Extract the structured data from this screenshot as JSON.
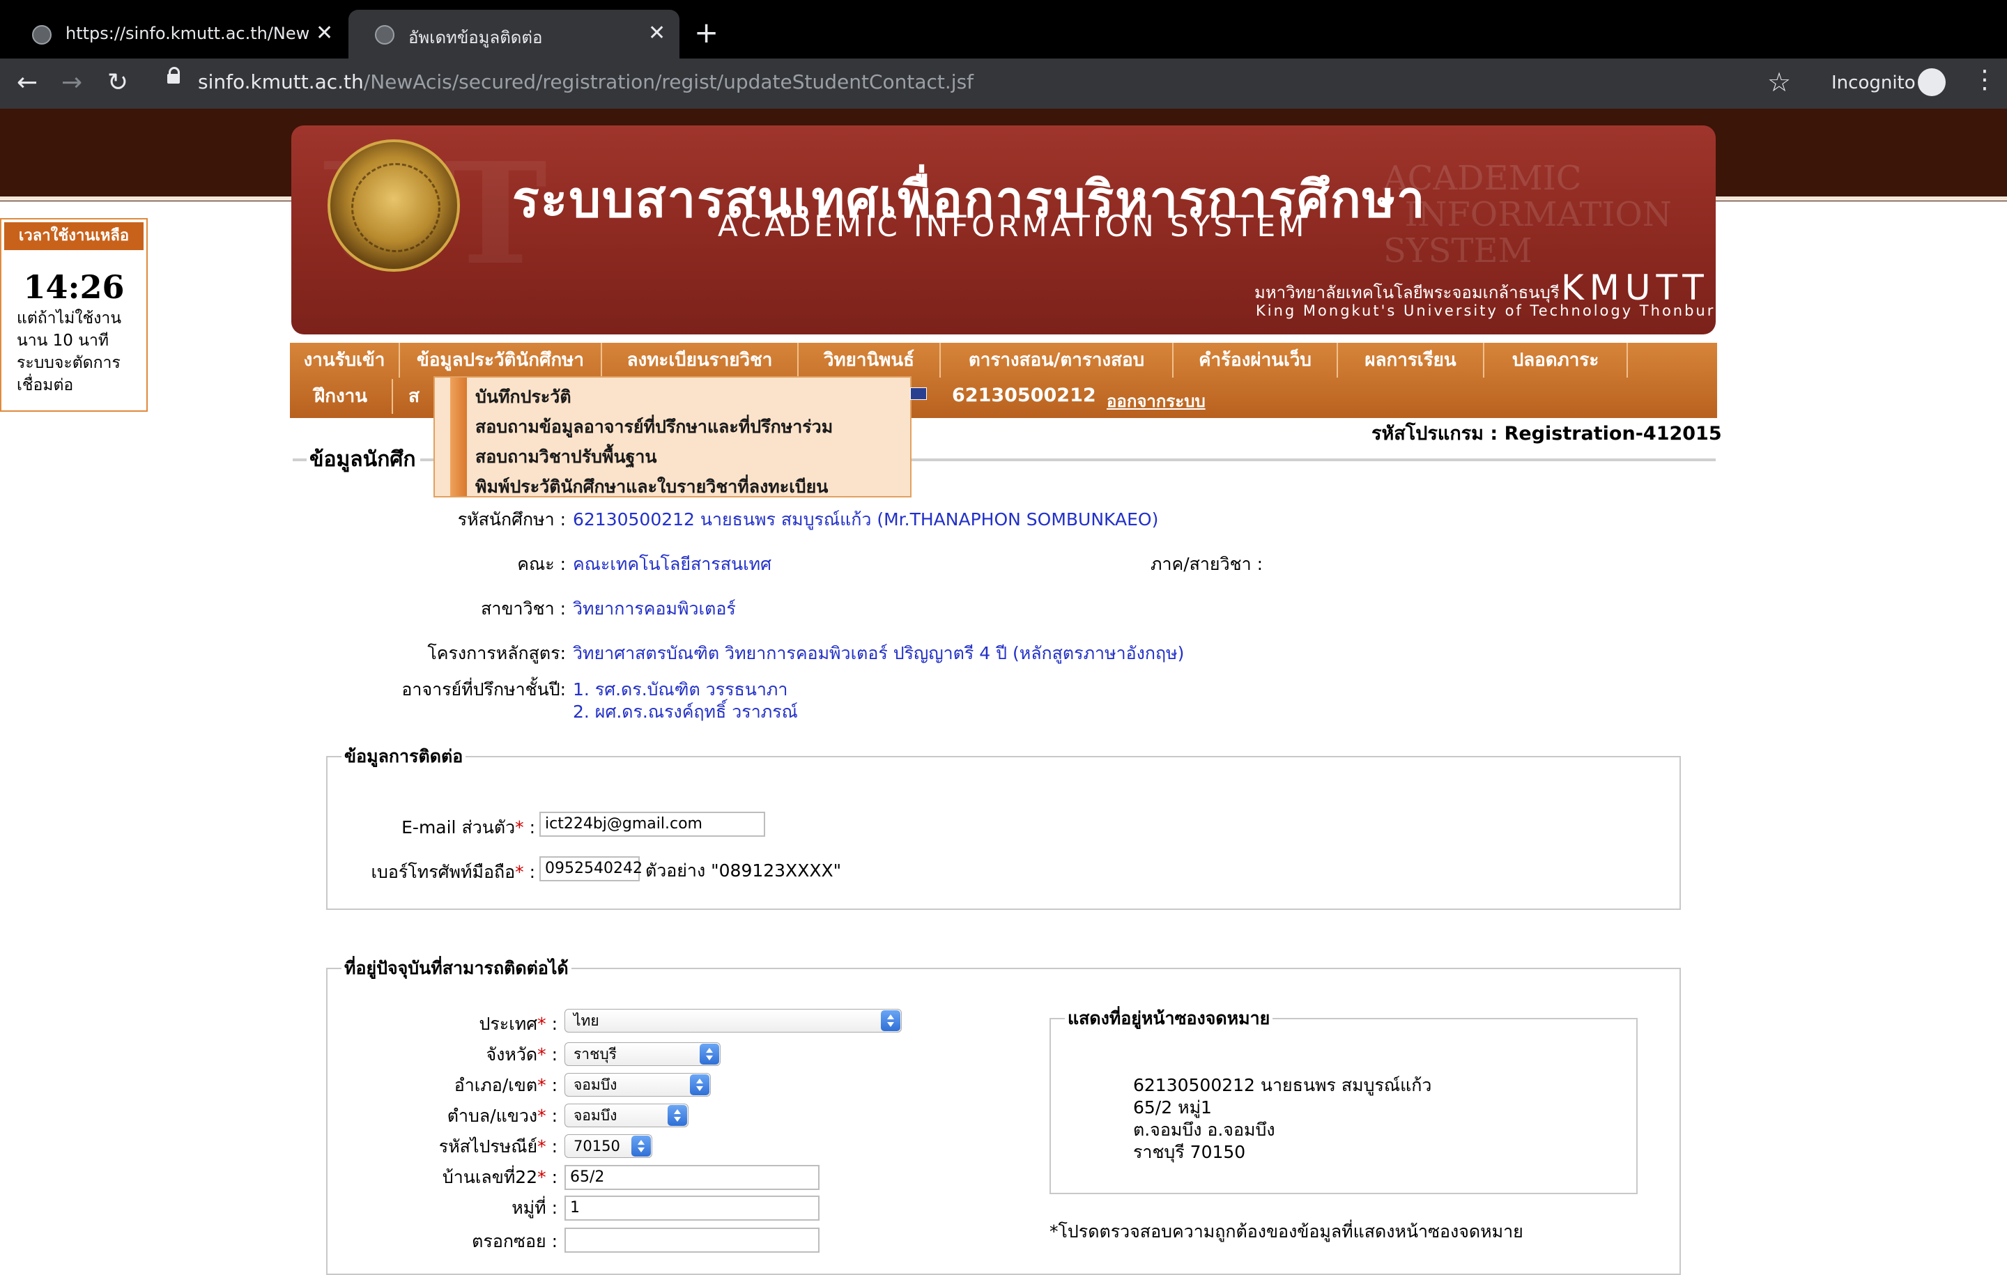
{
  "browser": {
    "tabs": [
      {
        "title": "https://sinfo.kmutt.ac.th/NewAcis/"
      },
      {
        "title": "อัพเดทข้อมูลติดต่อ"
      }
    ],
    "new_tab": "+",
    "url_host": "sinfo.kmutt.ac.th",
    "url_path": "/NewAcis/secured/registration/regist/updateStudentContact.jsf",
    "incognito_label": "Incognito"
  },
  "banner": {
    "title_th": "ระบบสารสนเทศเพื่อการบริหารการศึกษา",
    "title_en": "ACADEMIC INFORMATION SYSTEM",
    "university_th": "มหาวิทยาลัยเทคโนโลยีพระจอมเกล้าธนบุรี",
    "university_abbr": "KMUTT",
    "university_en": "King Mongkut's University of Technology Thonburi"
  },
  "session": {
    "header": "เวลาใช้งานเหลือ",
    "time": "14:26",
    "message": "แต่ถ้าไม่ใช้งานนาน 10 นาที ระบบจะตัดการเชื่อมต่อ"
  },
  "nav": {
    "row1": [
      "งานรับเข้า",
      "ข้อมูลประวัตินักศึกษา",
      "ลงทะเบียนรายวิชา",
      "วิทยานิพนธ์",
      "ตารางสอน/ตารางสอบ",
      "คำร้องผ่านเว็บ",
      "ผลการเรียน",
      "ปลอดภาระ"
    ],
    "row2": [
      "ฝึกงาน",
      "ส"
    ],
    "user_id": "62130500212",
    "logout": "ออกจากระบบ"
  },
  "dropdown": {
    "items": [
      "บันทึกประวัติ",
      "สอบถามข้อมูลอาจารย์ที่ปรึกษาและที่ปรึกษาร่วม",
      "สอบถามวิชาปรับพื้นฐาน",
      "พิมพ์ประวัตินักศึกษาและใบรายวิชาที่ลงทะเบียน"
    ]
  },
  "page": {
    "program_code": "รหัสโปรแกรม : Registration-412015",
    "section_title": "ข้อมูลนักศึก"
  },
  "student": {
    "id_label": "รหัสนักศึกษา :",
    "id_value": "62130500212 นายธนพร สมบูรณ์แก้ว (Mr.THANAPHON SOMBUNKAEO)",
    "faculty_label": "คณะ :",
    "faculty_value": "คณะเทคโนโลยีสารสนเทศ",
    "department_label": "ภาค/สายวิชา :",
    "major_label": "สาขาวิชา :",
    "major_value": "วิทยาการคอมพิวเตอร์",
    "curriculum_label": "โครงการหลักสูตร:",
    "curriculum_value": "วิทยาศาสตรบัณฑิต วิทยาการคอมพิวเตอร์ ปริญญาตรี 4 ปี (หลักสูตรภาษาอังกฤษ)",
    "advisor_label": "อาจารย์ที่ปรึกษาชั้นปี:",
    "advisors": [
      "1. รศ.ดร.บัณฑิต วรรธนาภา",
      "2. ผศ.ดร.ณรงค์ฤทธิ์ วราภรณ์"
    ]
  },
  "contact": {
    "legend": "ข้อมูลการติดต่อ",
    "email_label": "E-mail ส่วนตัว",
    "email_value": "ict224bj@gmail.com",
    "phone_label": "เบอร์โทรศัพท์มือถือ",
    "phone_value": "0952540242",
    "phone_example": "ตัวอย่าง \"089123XXXX\"",
    "required_mark": "*",
    "colon": " :"
  },
  "address": {
    "legend": "ที่อยู่ปัจจุบันที่สามารถติดต่อได้",
    "country_label": "ประเทศ",
    "country_value": "ไทย",
    "province_label": "จังหวัด",
    "province_value": "ราชบุรี",
    "district_label": "อำเภอ/เขต",
    "district_value": "จอมบึง",
    "subdistrict_label": "ตำบล/แขวง",
    "subdistrict_value": "จอมบึง",
    "postcode_label": "รหัสไปรษณีย์",
    "postcode_value": "70150",
    "house_no_label": "บ้านเลขที่22",
    "house_no_value": "65/2",
    "moo_label": "หมู่ที่ :",
    "moo_value": "1",
    "soi_label": "ตรอกซอย :",
    "soi_value": ""
  },
  "envelope": {
    "legend": "แสดงที่อยู่หน้าซองจดหมาย",
    "lines": [
      "62130500212 นายธนพร สมบูรณ์แก้ว",
      "65/2 หมู่1",
      "ต.จอมบึง อ.จอมบึง",
      "ราชบุรี 70150"
    ],
    "note": "*โปรดตรวจสอบความถูกต้องของข้อมูลที่แสดงหน้าซองจดหมาย"
  },
  "colors": {
    "nav": "#c46f28",
    "banner": "#8e2a22",
    "link": "#2230c8"
  }
}
